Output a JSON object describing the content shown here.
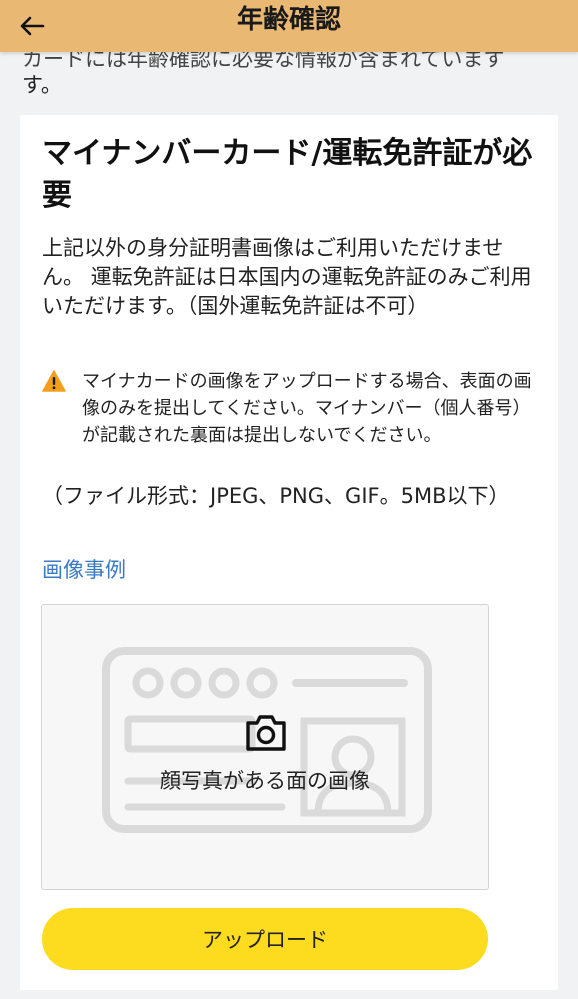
{
  "header": {
    "title": "年齢確認",
    "back_icon": "arrow-left-icon"
  },
  "intro": {
    "clipped_line": "カードには年齢確認に必要な情報が含まれています",
    "last_line": "す。"
  },
  "card": {
    "title": "マイナンバーカード/運転免許証が必要",
    "description": "上記以外の身分証明書画像はご利用いただけません。 運転免許証は日本国内の運転免許証のみご利用いただけます。（国外運転免許証は不可）",
    "warning": {
      "icon": "warning-triangle-icon",
      "text": "マイナカードの画像をアップロードする場合、表面の画像のみを提出してください。マイナンバー（個人番号）が記載された裏面は提出しないでください。"
    },
    "file_format": "（ファイル形式：JPEG、PNG、GIF。5MB以下）",
    "example_link": "画像事例",
    "upload_area": {
      "icon": "camera-icon",
      "label": "顔写真がある面の画像"
    },
    "upload_button": "アップロード"
  },
  "colors": {
    "header_bg": "#e9b872",
    "link": "#3a7ac2",
    "warning": "#f2a01c",
    "button_bg": "#fddb1f",
    "illustration": "#dadada"
  }
}
